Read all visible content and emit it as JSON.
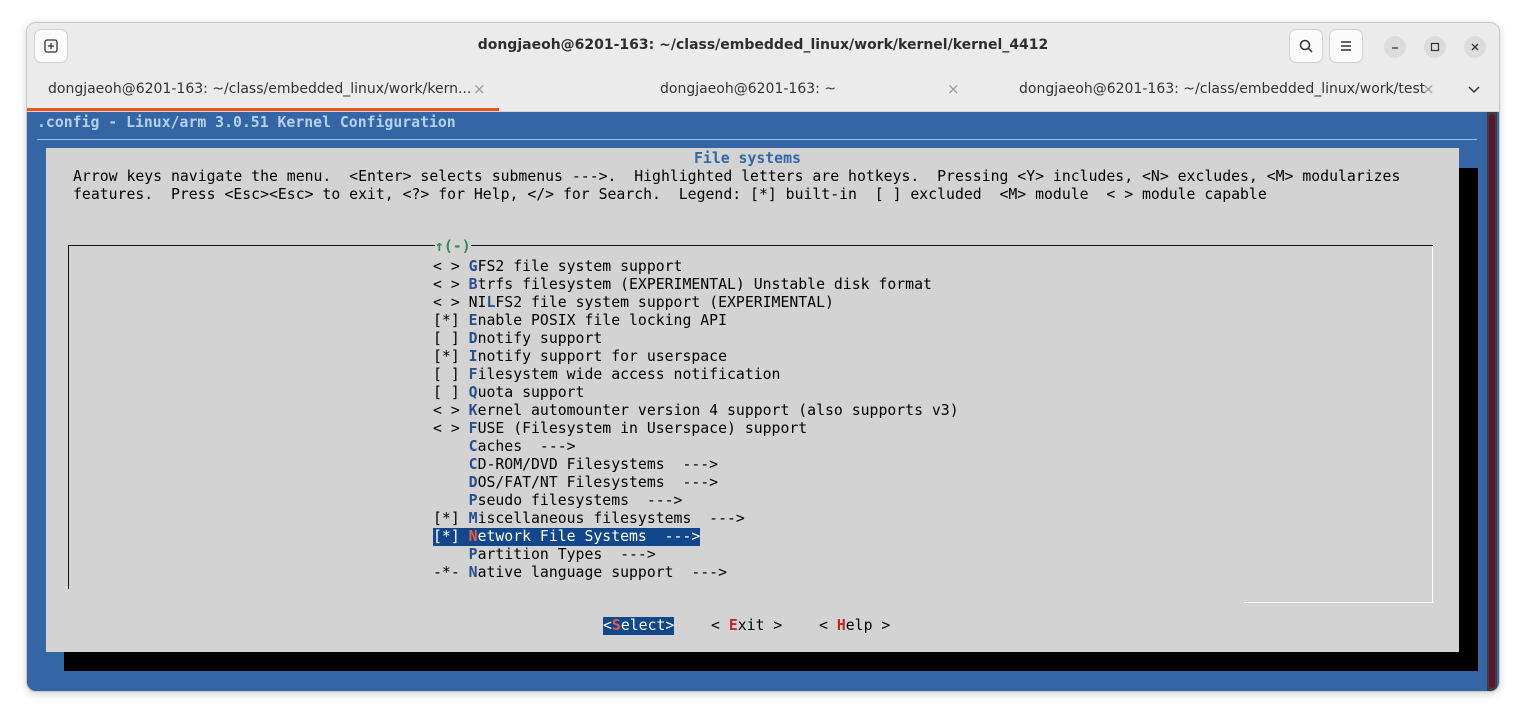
{
  "window": {
    "title": "dongjaeoh@6201-163: ~/class/embedded_linux/work/kernel/kernel_4412"
  },
  "tabs": [
    {
      "label": "dongjaeoh@6201-163: ~/class/embedded_linux/work/kern...",
      "close": "×"
    },
    {
      "label": "dongjaeoh@6201-163: ~",
      "close": "×"
    },
    {
      "label": "dongjaeoh@6201-163: ~/class/embedded_linux/work/test",
      "close": "×"
    }
  ],
  "terminal": {
    "config_title": ".config - Linux/arm 3.0.51 Kernel Configuration",
    "dialog_title": "File systems",
    "help_line1": "Arrow keys navigate the menu.  <Enter> selects submenus --->.  Highlighted letters are hotkeys.  Pressing <Y> includes, <N> excludes, <M> modularizes",
    "help_line2": "features.  Press <Esc><Esc> to exit, <?> for Help, </> for Search.  Legend: [*] built-in  [ ] excluded  <M> module  < > module capable",
    "scroll_indicator": "↑(-)",
    "items": [
      {
        "prefix": "< > ",
        "hot": "G",
        "rest": "FS2 file system support"
      },
      {
        "prefix": "< > ",
        "hot": "B",
        "rest": "trfs filesystem (EXPERIMENTAL) Unstable disk format"
      },
      {
        "prefix": "< > ",
        "pre": "NI",
        "hot": "L",
        "rest": "FS2 file system support (EXPERIMENTAL)"
      },
      {
        "prefix": "[*] ",
        "hot": "E",
        "rest": "nable POSIX file locking API"
      },
      {
        "prefix": "[ ] ",
        "hot": "D",
        "rest": "notify support"
      },
      {
        "prefix": "[*] ",
        "hot": "I",
        "rest": "notify support for userspace"
      },
      {
        "prefix": "[ ] ",
        "hot": "F",
        "rest": "ilesystem wide access notification"
      },
      {
        "prefix": "[ ] ",
        "hot": "Q",
        "rest": "uota support"
      },
      {
        "prefix": "< > ",
        "hot": "K",
        "rest": "ernel automounter version 4 support (also supports v3)"
      },
      {
        "prefix": "< > ",
        "hot": "F",
        "rest": "USE (Filesystem in Userspace) support"
      },
      {
        "prefix": "    ",
        "hot": "C",
        "rest": "aches  --->"
      },
      {
        "prefix": "    ",
        "hot": "C",
        "rest": "D-ROM/DVD Filesystems  --->"
      },
      {
        "prefix": "    ",
        "hot": "D",
        "rest": "OS/FAT/NT Filesystems  --->"
      },
      {
        "prefix": "    ",
        "hot": "P",
        "rest": "seudo filesystems  --->"
      },
      {
        "prefix": "[*] ",
        "hot": "M",
        "rest": "iscellaneous filesystems  --->"
      },
      {
        "prefix": "[*] ",
        "hot": "N",
        "rest": "etwork File Systems  --->",
        "selected": true
      },
      {
        "prefix": "    ",
        "hot": "P",
        "rest": "artition Types  --->"
      },
      {
        "prefix": "-*- ",
        "hot": "N",
        "rest": "ative language support  --->"
      }
    ],
    "buttons": [
      {
        "pre": "<",
        "hot": "S",
        "rest": "elect>",
        "selected": true
      },
      {
        "pre": "< ",
        "hot": "E",
        "rest": "xit >"
      },
      {
        "pre": "< ",
        "hot": "H",
        "rest": "elp >"
      }
    ]
  }
}
